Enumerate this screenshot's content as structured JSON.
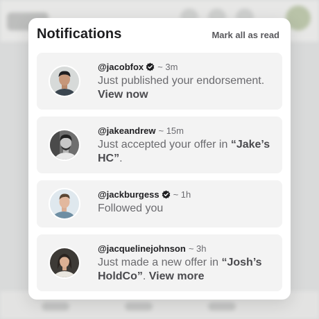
{
  "panel": {
    "title": "Notifications",
    "mark_all_label": "Mark all as read"
  },
  "notifications": [
    {
      "handle": "@jacobfox",
      "verified": true,
      "time": "~ 3m",
      "message_prefix": "Just published your endorsement.",
      "link": "View now",
      "avatar_icon": "user-photo"
    },
    {
      "handle": "@jakeandrew",
      "verified": false,
      "time": "~ 15m",
      "message_prefix": "Just accepted your offer in",
      "quoted": "“Jake’s HC”",
      "message_suffix": ".",
      "avatar_icon": "user-photo"
    },
    {
      "handle": "@jackburgess",
      "verified": true,
      "time": "~ 1h",
      "message_prefix": "Followed you",
      "avatar_icon": "user-photo"
    },
    {
      "handle": "@jacquelinejohnson",
      "verified": false,
      "time": "~ 3h",
      "message_prefix": "Just made a new offer in",
      "quoted": "“Josh’s HoldCo”",
      "message_suffix": ".",
      "link": "View more",
      "avatar_icon": "user-photo"
    }
  ]
}
